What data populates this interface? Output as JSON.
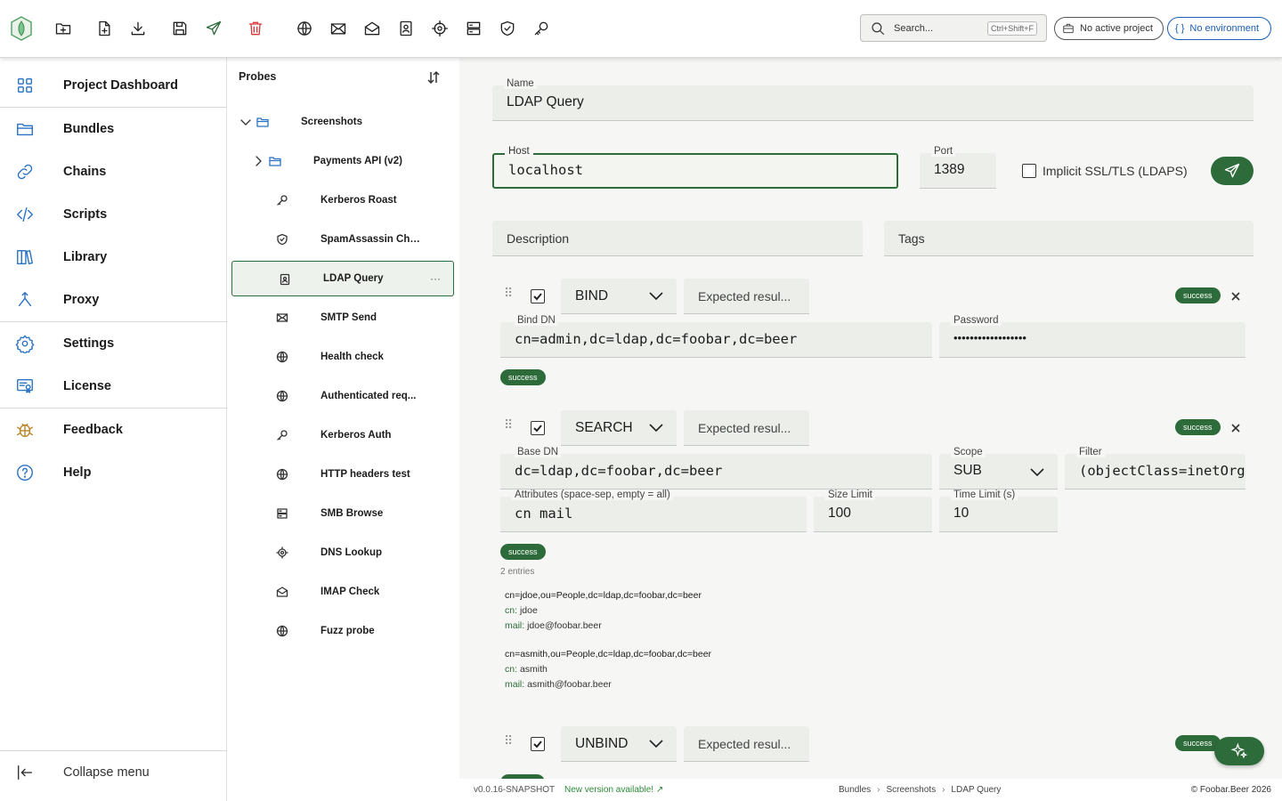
{
  "toolbar": {
    "icons": [
      "new-folder-icon",
      "new-file-icon",
      "download-icon",
      "save-icon",
      "send-icon",
      "delete-icon",
      "globe-icon",
      "mail-icon",
      "mail-open-icon",
      "contact-book-icon",
      "target-icon",
      "server-icon",
      "shield-check-icon",
      "key-icon"
    ],
    "search_placeholder": "Search...",
    "search_shortcut": "Ctrl+Shift+F",
    "project": "No active project",
    "environment": "No environment"
  },
  "nav": {
    "items": [
      {
        "label": "Project Dashboard",
        "icon": "grid-icon"
      },
      {
        "label": "Bundles",
        "icon": "folder-icon"
      },
      {
        "label": "Chains",
        "icon": "link-icon"
      },
      {
        "label": "Scripts",
        "icon": "code-icon"
      },
      {
        "label": "Library",
        "icon": "books-icon"
      },
      {
        "label": "Proxy",
        "icon": "split-arrows-icon"
      },
      {
        "label": "Settings",
        "icon": "gear-icon"
      },
      {
        "label": "License",
        "icon": "certificate-icon"
      },
      {
        "label": "Feedback",
        "icon": "bug-icon"
      },
      {
        "label": "Help",
        "icon": "help-icon"
      }
    ],
    "collapse": "Collapse menu"
  },
  "probes": {
    "header": "Probes",
    "items": [
      {
        "label": "Screenshots",
        "type": "folder",
        "expanded": true
      },
      {
        "label": "Payments API (v2)",
        "type": "folder",
        "expanded": false
      },
      {
        "label": "Kerberos Roast",
        "icon": "key-icon"
      },
      {
        "label": "SpamAssassin Che...",
        "icon": "shield-icon"
      },
      {
        "label": "LDAP Query",
        "icon": "contact-book-icon",
        "selected": true
      },
      {
        "label": "SMTP Send",
        "icon": "mail-icon"
      },
      {
        "label": "Health check",
        "icon": "globe-icon"
      },
      {
        "label": "Authenticated req...",
        "icon": "globe-icon"
      },
      {
        "label": "Kerberos Auth",
        "icon": "key-icon"
      },
      {
        "label": "HTTP headers test",
        "icon": "globe-icon"
      },
      {
        "label": "SMB Browse",
        "icon": "server-icon"
      },
      {
        "label": "DNS Lookup",
        "icon": "target-icon"
      },
      {
        "label": "IMAP Check",
        "icon": "mail-open-icon"
      },
      {
        "label": "Fuzz probe",
        "icon": "globe-icon"
      }
    ],
    "more": "···"
  },
  "editor": {
    "name_label": "Name",
    "name": "LDAP Query",
    "host_label": "Host",
    "host": "localhost",
    "port_label": "Port",
    "port": "1389",
    "ssl_label": "Implicit SSL/TLS (LDAPS)",
    "ssl_checked": false,
    "description_placeholder": "Description",
    "tags_placeholder": "Tags",
    "expected_placeholder": "Expected resul...",
    "steps": [
      {
        "op": "BIND",
        "status": "success",
        "bind_dn_label": "Bind DN",
        "bind_dn": "cn=admin,dc=ldap,dc=foobar,dc=beer",
        "password_label": "Password",
        "password": "••••••••••••••••••",
        "result": "success"
      },
      {
        "op": "SEARCH",
        "status": "success",
        "base_dn_label": "Base DN",
        "base_dn": "dc=ldap,dc=foobar,dc=beer",
        "scope_label": "Scope",
        "scope": "SUB",
        "filter_label": "Filter",
        "filter": "(objectClass=inetOrgPerson)",
        "attributes_label": "Attributes (space-sep, empty = all)",
        "attributes": "cn mail",
        "size_limit_label": "Size Limit",
        "size_limit": "100",
        "time_limit_label": "Time Limit (s)",
        "time_limit": "10",
        "result": "success",
        "entries_count": "2 entries",
        "entries": [
          {
            "dn": "cn=jdoe,ou=People,dc=ldap,dc=foobar,dc=beer",
            "cn_key": "cn:",
            "cn": "jdoe",
            "mail_key": "mail:",
            "mail": "jdoe@foobar.beer"
          },
          {
            "dn": "cn=asmith,ou=People,dc=ldap,dc=foobar,dc=beer",
            "cn_key": "cn:",
            "cn": "asmith",
            "mail_key": "mail:",
            "mail": "asmith@foobar.beer"
          }
        ]
      },
      {
        "op": "UNBIND",
        "status": "success"
      }
    ]
  },
  "footer": {
    "version": "v0.0.16-SNAPSHOT",
    "new_version": "New version available! ↗",
    "breadcrumbs": [
      "Bundles",
      "Screenshots",
      "LDAP Query"
    ],
    "copyright": "© Foobar.Beer 2026"
  },
  "colors": {
    "accent": "#2e6b3a",
    "nav_icon": "#2a72c4",
    "danger": "#d43b3b",
    "environment": "#1a5fb4"
  }
}
